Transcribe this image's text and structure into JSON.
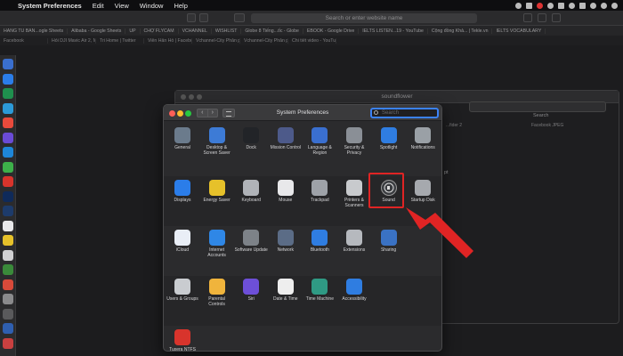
{
  "menubar": {
    "app_name": "System Preferences",
    "items": [
      "Edit",
      "View",
      "Window",
      "Help"
    ]
  },
  "browser": {
    "url_placeholder": "Search or enter website name",
    "bookmarks": [
      "HANG TU BAN...ogle Sheets",
      "Alibaba - Google Sheets",
      "UP",
      "CHỢ FLYCAM",
      "VCHANNEL",
      "WISHLIST",
      "Globe 8 Tiếng...ốc - Globe",
      "EBOOK - Google Drive",
      "IELTS LISTEN...19 - YouTube",
      "Cộng đồng Khả... | Tekle.vn",
      "IELTS VOCABULARY"
    ],
    "tabs": [
      "Facebook",
      "Hỏi DJI Mavic Air 2, Mavi...",
      "Tri Home | Twitter",
      "Viễn Hản Hồ | Facebook",
      "Vchannel-City Phân phối...",
      "Vchannel-City Phân phối...",
      "Chi tiết video - YouTube"
    ]
  },
  "finder": {
    "title": "soundflower",
    "search_label": "Search",
    "column_1": "...fider 2",
    "column_2": "Facebook JPEG",
    "snippet": "pt"
  },
  "prefs": {
    "title": "System Preferences",
    "search_placeholder": "Search",
    "nav_back": "‹",
    "nav_forward": "›",
    "highlighted_pane": "Sound",
    "rows": [
      [
        {
          "label": "General",
          "icon": "general-icon",
          "color": "#6b7b8c"
        },
        {
          "label": "Desktop & Screen Saver",
          "icon": "desktop-icon",
          "color": "#3d7bd6"
        },
        {
          "label": "Dock",
          "icon": "dock-icon",
          "color": "#222428"
        },
        {
          "label": "Mission Control",
          "icon": "mission-control-icon",
          "color": "#4d5a8a"
        },
        {
          "label": "Language & Region",
          "icon": "flag-icon",
          "color": "#3a6fcf"
        },
        {
          "label": "Security & Privacy",
          "icon": "house-icon",
          "color": "#8a8f96"
        },
        {
          "label": "Spotlight",
          "icon": "magnifier-icon",
          "color": "#2f7de1"
        },
        {
          "label": "Notifications",
          "icon": "notifications-icon",
          "color": "#9aa0a6"
        }
      ],
      [
        {
          "label": "Displays",
          "icon": "display-icon",
          "color": "#2b7de9"
        },
        {
          "label": "Energy Saver",
          "icon": "bulb-icon",
          "color": "#e6c12a"
        },
        {
          "label": "Keyboard",
          "icon": "keyboard-icon",
          "color": "#b0b3b8"
        },
        {
          "label": "Mouse",
          "icon": "mouse-icon",
          "color": "#e8e8ea"
        },
        {
          "label": "Trackpad",
          "icon": "trackpad-icon",
          "color": "#9ea2a8"
        },
        {
          "label": "Printers & Scanners",
          "icon": "printer-icon",
          "color": "#c8cacd"
        },
        {
          "label": "Sound",
          "icon": "speaker-icon",
          "color": "#3a3c40"
        },
        {
          "label": "Startup Disk",
          "icon": "disk-icon",
          "color": "#a6a9ae"
        }
      ],
      [
        {
          "label": "iCloud",
          "icon": "cloud-icon",
          "color": "#e9eef6"
        },
        {
          "label": "Internet Accounts",
          "icon": "at-icon",
          "color": "#2f87e6"
        },
        {
          "label": "Software Update",
          "icon": "gear-icon",
          "color": "#7d8288"
        },
        {
          "label": "Network",
          "icon": "globe-icon",
          "color": "#5b6c86"
        },
        {
          "label": "Bluetooth",
          "icon": "bluetooth-icon",
          "color": "#2f7de1"
        },
        {
          "label": "Extensions",
          "icon": "puzzle-icon",
          "color": "#b6b9be"
        },
        {
          "label": "Sharing",
          "icon": "sharing-icon",
          "color": "#3a72c4"
        }
      ],
      [
        {
          "label": "Users & Groups",
          "icon": "users-icon",
          "color": "#c9ccd0"
        },
        {
          "label": "Parental Controls",
          "icon": "parental-icon",
          "color": "#f0b43c"
        },
        {
          "label": "Siri",
          "icon": "siri-icon",
          "color": "#6d4fd8"
        },
        {
          "label": "Date & Time",
          "icon": "clock-icon",
          "color": "#eeeeee"
        },
        {
          "label": "Time Machine",
          "icon": "time-machine-icon",
          "color": "#2f9a84"
        },
        {
          "label": "Accessibility",
          "icon": "accessibility-icon",
          "color": "#2f7de1"
        }
      ],
      [
        {
          "label": "Tuxera NTFS",
          "icon": "tuxera-icon",
          "color": "#d8342c"
        }
      ]
    ]
  },
  "annotation": {
    "box_color": "#e02424",
    "arrow_color": "#e02424"
  }
}
